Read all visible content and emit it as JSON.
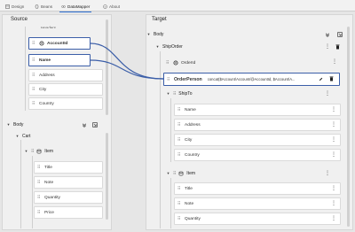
{
  "tabs": [
    {
      "label": "Design"
    },
    {
      "label": "Beans"
    },
    {
      "label": "DataMapper"
    },
    {
      "label": "About"
    }
  ],
  "source": {
    "title": "Source",
    "clipped_label": "Headers",
    "account_fields": [
      "AccountId",
      "Name",
      "Address",
      "City",
      "Country"
    ],
    "body_label": "Body",
    "cart_label": "Cart",
    "item_label": "Item",
    "item_fields": [
      "Title",
      "Note",
      "Quantity",
      "Price"
    ]
  },
  "target": {
    "title": "Target",
    "body_label": "Body",
    "shiporder_label": "ShipOrder",
    "orderid_label": "OrderId",
    "orderperson_label": "OrderPerson",
    "orderperson_expr": "concat($Account/Account/@AccountId, $Account/A...",
    "shipto_label": "ShipTo",
    "shipto_fields": [
      "Name",
      "Address",
      "City",
      "Country"
    ],
    "item_label": "Item",
    "item_fields": [
      "Title",
      "Note",
      "Quantity"
    ]
  },
  "colors": {
    "accent": "#2d6ed3",
    "link_line": "#3b5ea8"
  }
}
